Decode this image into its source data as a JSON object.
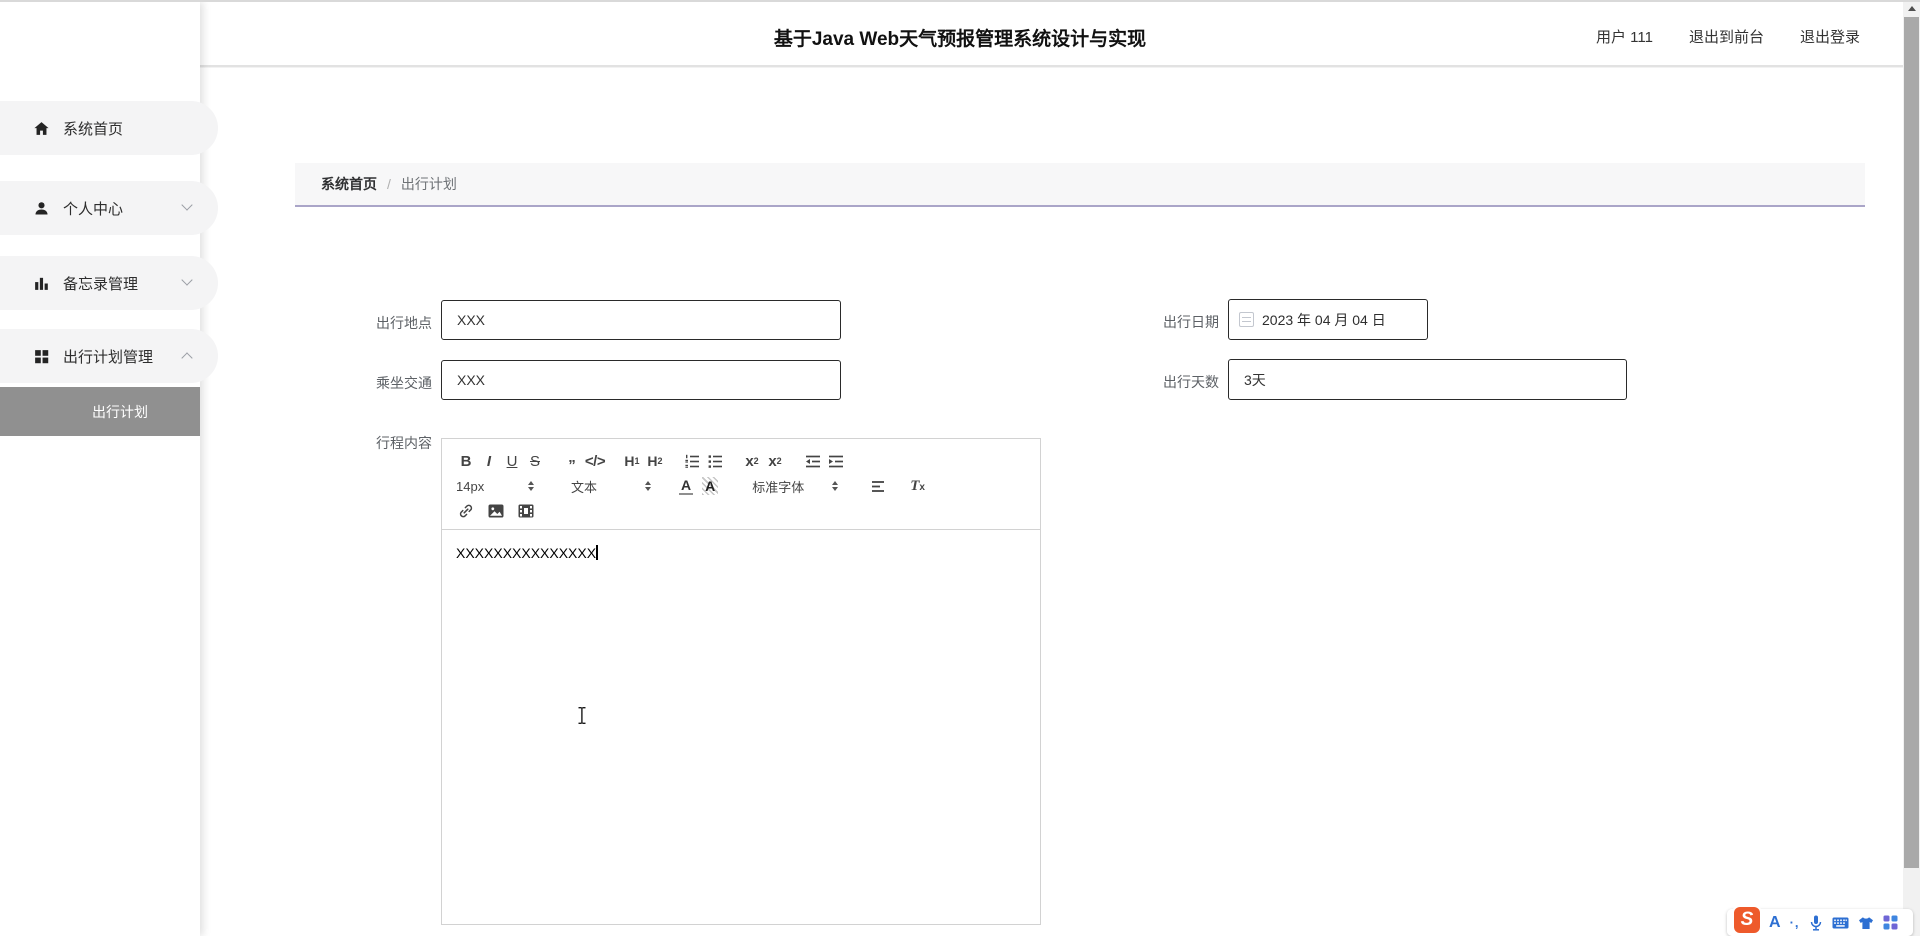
{
  "header": {
    "title": "基于Java Web天气预报管理系统设计与实现",
    "links": {
      "user": "用户 111",
      "to_front": "退出到前台",
      "logout": "退出登录"
    }
  },
  "sidebar": {
    "items": [
      {
        "label": "系统首页",
        "icon": "home"
      },
      {
        "label": "个人中心",
        "icon": "user",
        "chevron": "down"
      },
      {
        "label": "备忘录管理",
        "icon": "bar-chart",
        "chevron": "down"
      },
      {
        "label": "出行计划管理",
        "icon": "grid",
        "chevron": "up"
      }
    ],
    "active_subitem": {
      "label": "出行计划"
    }
  },
  "breadcrumb": {
    "root": "系统首页",
    "separator": "/",
    "current": "出行计划"
  },
  "form": {
    "location": {
      "label": "出行地点",
      "value": "XXX"
    },
    "date": {
      "label": "出行日期",
      "value": "2023 年 04 月 04 日"
    },
    "transport": {
      "label": "乘坐交通",
      "value": "XXX"
    },
    "days": {
      "label": "出行天数",
      "value": "3天"
    },
    "content": {
      "label": "行程内容"
    }
  },
  "editor": {
    "toolbar": {
      "bold": "B",
      "italic": "I",
      "underline": "U",
      "strike": "S",
      "blockquote": "”",
      "code": "</>",
      "h1": {
        "base": "H",
        "sub": "1"
      },
      "h2": {
        "base": "H",
        "sub": "2"
      },
      "subscript": {
        "base": "x",
        "sub": "2"
      },
      "superscript": {
        "base": "x",
        "sup": "2"
      },
      "size": "14px",
      "paragraph": "文本",
      "font": "标准字体",
      "color": "A",
      "background": "A",
      "clean": {
        "base": "T",
        "sub": "x"
      }
    },
    "content": "XXXXXXXXXXXXXXX"
  },
  "ime": {
    "logo": "S",
    "letter": "A",
    "punctuation": "·,"
  },
  "colors": {
    "breadcrumb_underline": "#aaa5c8",
    "active_item_bg": "#909090",
    "ime_blue": "#2d6fd2",
    "ime_orange": "#ee5a2b"
  }
}
